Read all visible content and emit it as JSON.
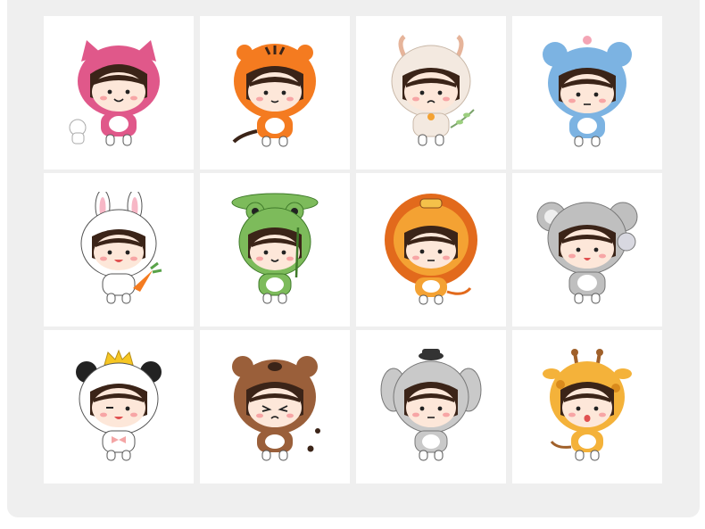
{
  "gallery": {
    "items": [
      {
        "animal": "cat",
        "accent": "#e0588a",
        "icon": "cat-costume-icon"
      },
      {
        "animal": "tiger",
        "accent": "#f47b20",
        "icon": "tiger-costume-icon"
      },
      {
        "animal": "goat",
        "accent": "#f3e9e0",
        "icon": "goat-costume-icon"
      },
      {
        "animal": "mouse",
        "accent": "#7cb3e2",
        "icon": "mouse-costume-icon"
      },
      {
        "animal": "rabbit",
        "accent": "#ffffff",
        "icon": "rabbit-costume-icon"
      },
      {
        "animal": "frog",
        "accent": "#7dbb5b",
        "icon": "frog-costume-icon"
      },
      {
        "animal": "lion",
        "accent": "#f08a24",
        "icon": "lion-costume-icon"
      },
      {
        "animal": "koala",
        "accent": "#bfbfbf",
        "icon": "koala-costume-icon"
      },
      {
        "animal": "panda",
        "accent": "#ffffff",
        "icon": "panda-costume-icon"
      },
      {
        "animal": "bear",
        "accent": "#9a5f3a",
        "icon": "bear-costume-icon"
      },
      {
        "animal": "elephant",
        "accent": "#c9c9c9",
        "icon": "elephant-costume-icon"
      },
      {
        "animal": "giraffe",
        "accent": "#f4b23a",
        "icon": "giraffe-costume-icon"
      }
    ]
  }
}
